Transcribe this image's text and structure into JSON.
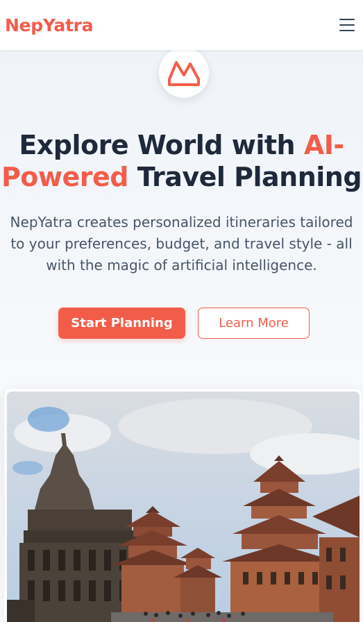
{
  "header": {
    "brand": "NepYatra",
    "menu_icon": "hamburger-menu-icon"
  },
  "hero": {
    "logo_icon": "mountain-logo-icon",
    "title_part1": "Explore World with ",
    "title_accent": "AI-Powered",
    "title_part2": " Travel Planning",
    "subtitle": "NepYatra creates personalized itineraries tailored to your preferences, budget, and travel style - all with the magic of artificial intelligence.",
    "primary_cta": "Start Planning",
    "secondary_cta": "Learn More"
  },
  "colors": {
    "accent": "#f25d4a",
    "heading": "#1e293b",
    "body": "#475569"
  }
}
